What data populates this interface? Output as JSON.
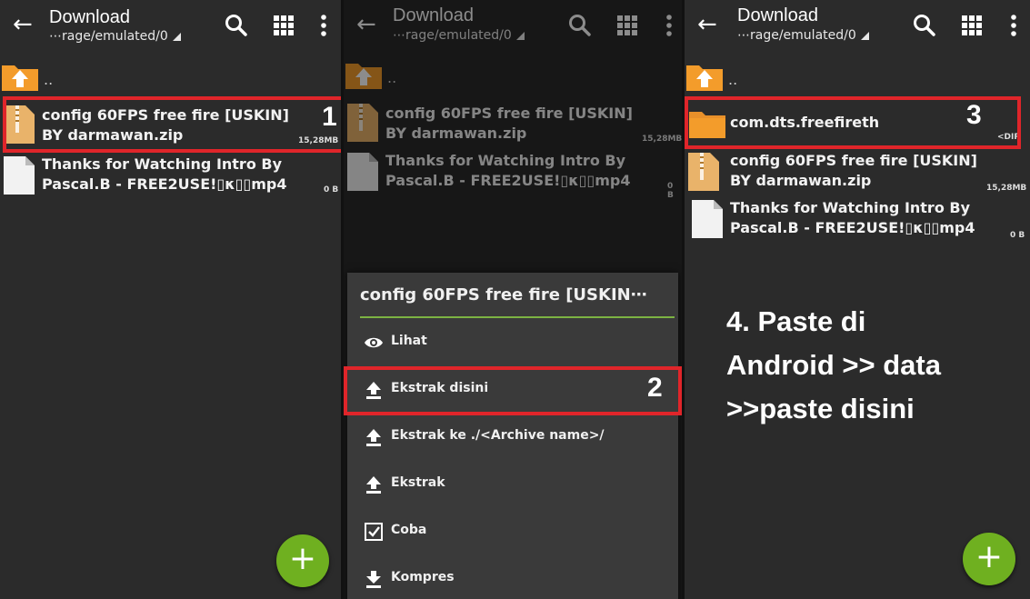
{
  "appbar": {
    "title": "Download",
    "path": "⋯rage/emulated/0",
    "back_icon": "arrow-left-icon",
    "search_icon": "search-icon",
    "grid_icon": "grid-view-icon",
    "more_icon": "more-vertical-icon"
  },
  "up_label": "..",
  "files": {
    "zip": {
      "line1": "config 60FPS free fire [USKIN]",
      "line2": "BY darmawan.zip",
      "size": "15,28MB"
    },
    "mp4": {
      "line1": "Thanks for Watching Intro By",
      "line2": "Pascal.B - FREE2USE!▯κ▯▯mp4",
      "size": "0 B"
    },
    "folder": {
      "name": "com.dts.freefireth",
      "size": "<DIR"
    }
  },
  "dialog": {
    "title": "config 60FPS free fire [USKIN⋯",
    "items": [
      {
        "label": "Lihat",
        "icon": "eye-icon"
      },
      {
        "label": "Ekstrak disini",
        "icon": "upload-icon"
      },
      {
        "label": "Ekstrak ke ./<Archive name>/",
        "icon": "upload-icon"
      },
      {
        "label": "Ekstrak",
        "icon": "upload-icon"
      },
      {
        "label": "Coba",
        "icon": "checkbox-icon"
      },
      {
        "label": "Kompres",
        "icon": "download-icon"
      }
    ]
  },
  "steps": {
    "s1": "1",
    "s2": "2",
    "s3": "3"
  },
  "instruction": "4. Paste di\nAndroid >> data\n>>paste disini",
  "fab_label": "+",
  "colors": {
    "accent": "#6fb020",
    "highlight": "#e0252a",
    "folder": "#f39c2b",
    "divider": "#7cb342"
  }
}
